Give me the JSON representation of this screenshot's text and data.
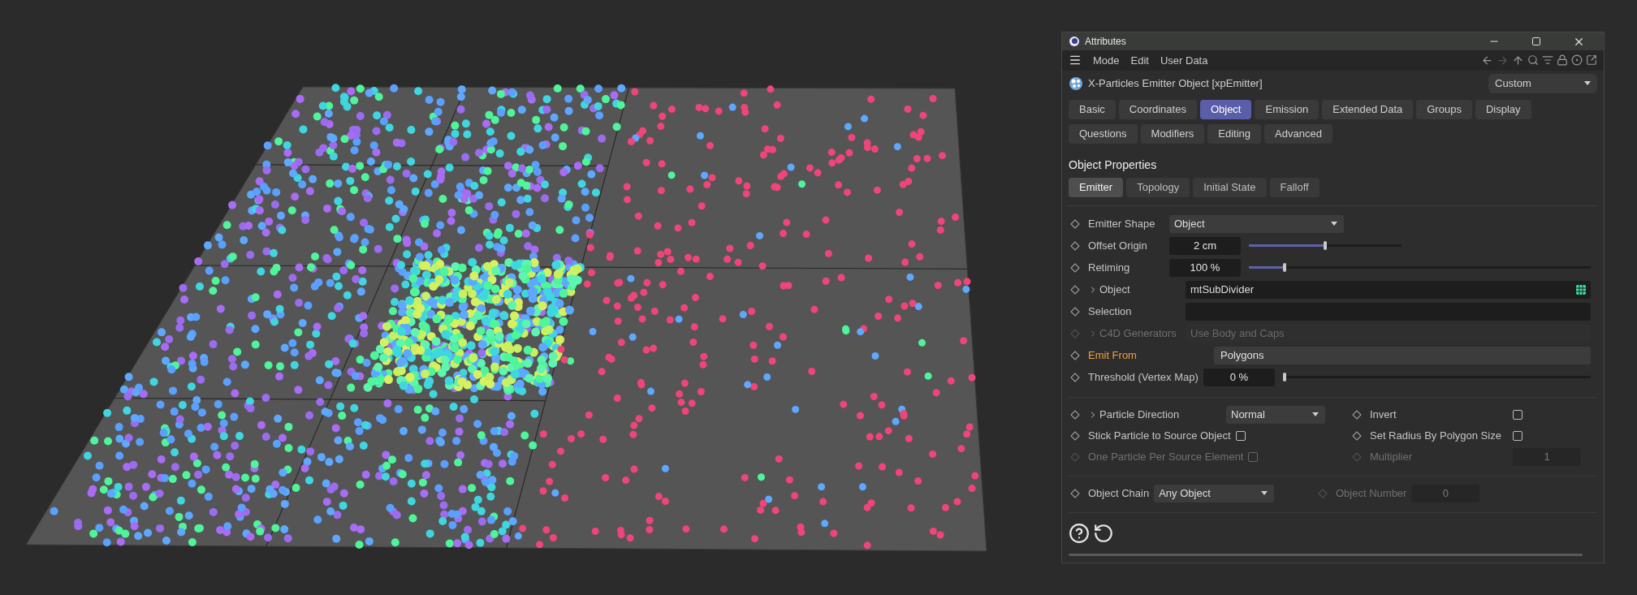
{
  "window": {
    "title": "Attributes"
  },
  "menu": [
    "Mode",
    "Edit",
    "User Data"
  ],
  "object": {
    "title": "X-Particles Emitter Object [xpEmitter]",
    "preset": "Custom"
  },
  "tabs": [
    {
      "label": "Basic",
      "selected": false
    },
    {
      "label": "Coordinates",
      "selected": false
    },
    {
      "label": "Object",
      "selected": true
    },
    {
      "label": "Emission",
      "selected": false
    },
    {
      "label": "Extended Data",
      "selected": false
    },
    {
      "label": "Groups",
      "selected": false
    },
    {
      "label": "Display",
      "selected": false
    },
    {
      "label": "Questions",
      "selected": false
    },
    {
      "label": "Modifiers",
      "selected": false
    },
    {
      "label": "Editing",
      "selected": false
    },
    {
      "label": "Advanced",
      "selected": false
    }
  ],
  "section": "Object Properties",
  "subtabs": [
    {
      "label": "Emitter",
      "selected": true
    },
    {
      "label": "Topology",
      "selected": false
    },
    {
      "label": "Initial State",
      "selected": false
    },
    {
      "label": "Falloff",
      "selected": false
    }
  ],
  "fields": [
    {
      "kind": "dropdown",
      "label": "Emitter Shape",
      "value": "Object"
    },
    {
      "kind": "slider-short",
      "label": "Offset Origin",
      "value": "2 cm",
      "level": 0.5
    },
    {
      "kind": "slider",
      "label": "Retiming",
      "value": "100 %",
      "level": 0.1
    },
    {
      "kind": "link",
      "label": "Object",
      "value": "mtSubDivider",
      "expandable": true
    },
    {
      "kind": "link",
      "label": "Selection"
    },
    {
      "kind": "text",
      "label": "C4D Generators",
      "value": "Use Body and Caps",
      "expandable": true,
      "disabled": true
    },
    {
      "kind": "select",
      "label": "Emit From",
      "value": "Polygons",
      "highlighted": true
    },
    {
      "kind": "slider",
      "label": "Threshold (Vertex Map)",
      "value": "0 %",
      "level": 0
    }
  ],
  "option_rows": [
    {
      "left": {
        "kind": "dropdown",
        "label": "Particle Direction",
        "value": "Normal",
        "expandable": true
      },
      "right": {
        "kind": "checkbox",
        "label": "Invert",
        "checked": false
      }
    },
    {
      "left": {
        "kind": "checkbox",
        "label": "Stick Particle to Source Object",
        "checked": false
      },
      "right": {
        "kind": "checkbox",
        "label": "Set Radius By Polygon Size",
        "checked": false
      }
    },
    {
      "left": {
        "kind": "checkbox",
        "label": "One Particle Per Source Element",
        "checked": false,
        "disabled": true
      },
      "right": {
        "kind": "number",
        "label": "Multiplier",
        "value": "1",
        "disabled": true
      }
    }
  ],
  "chain_rows": [
    {
      "left": {
        "kind": "dropdown",
        "label": "Object Chain",
        "value": "Any Object"
      },
      "right": {
        "kind": "number",
        "label": "Object Number",
        "value": "0",
        "disabled": true
      }
    }
  ]
}
